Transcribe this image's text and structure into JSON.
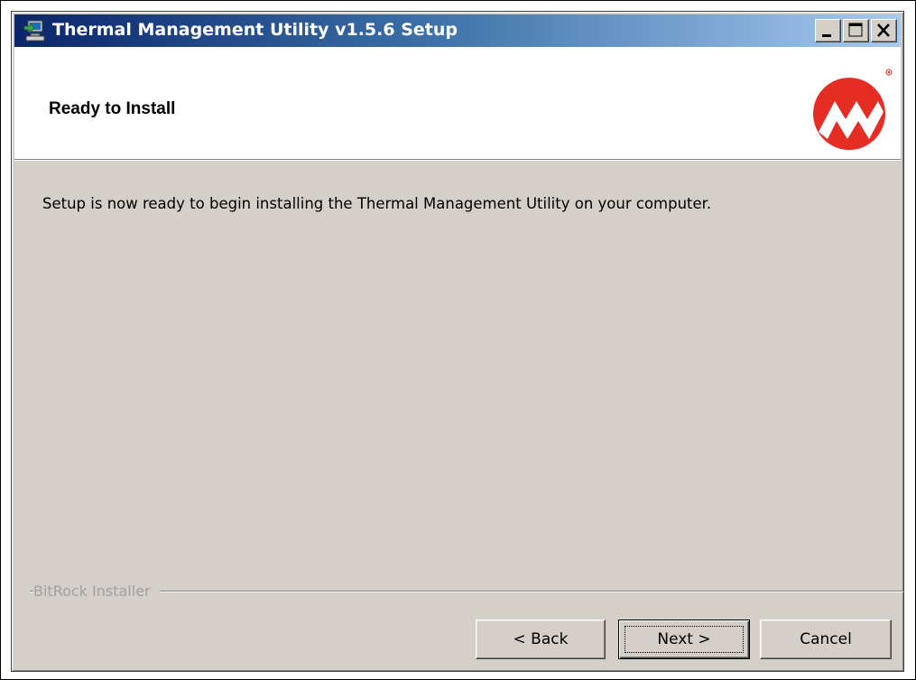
{
  "window": {
    "title": "Thermal Management Utility v1.5.6 Setup",
    "icon": "installer-computer-icon"
  },
  "header": {
    "title": "Ready to Install",
    "logo": "microchip-logo",
    "colors": {
      "logo_red": "#e52d24"
    }
  },
  "content": {
    "message": "Setup is now ready to begin installing the Thermal Management Utility on your computer."
  },
  "footer": {
    "brand": "BitRock Installer"
  },
  "buttons": {
    "back": "< Back",
    "next": "Next >",
    "cancel": "Cancel"
  },
  "colors": {
    "titlebar_start": "#0a246a",
    "titlebar_end": "#a6caf0",
    "face": "#d4d0c8"
  }
}
